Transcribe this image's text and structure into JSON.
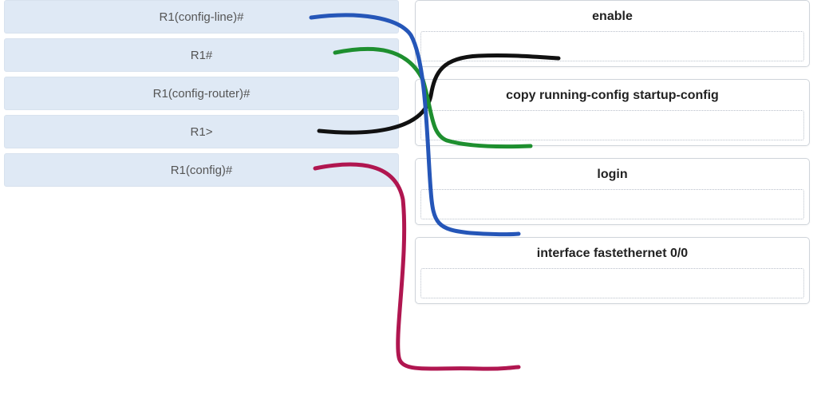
{
  "left": {
    "items": [
      {
        "label": "R1(config-line)#"
      },
      {
        "label": "R1#"
      },
      {
        "label": "R1(config-router)#"
      },
      {
        "label": "R1>"
      },
      {
        "label": "R1(config)#"
      }
    ]
  },
  "right": {
    "items": [
      {
        "label": "enable"
      },
      {
        "label": "copy running-config startup-config"
      },
      {
        "label": "login"
      },
      {
        "label": "interface fastethernet 0/0"
      }
    ]
  },
  "connections": [
    {
      "from": "R1(config-line)#",
      "to": "login",
      "color": "#2556b8"
    },
    {
      "from": "R1#",
      "to": "copy running-config startup-config",
      "color": "#1e8f2f"
    },
    {
      "from": "R1>",
      "to": "enable",
      "color": "#111111"
    },
    {
      "from": "R1(config)#",
      "to": "interface fastethernet 0/0",
      "color": "#b01650"
    }
  ]
}
